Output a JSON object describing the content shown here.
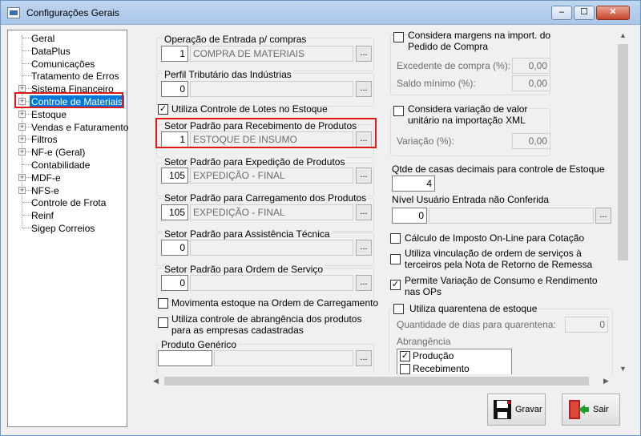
{
  "window": {
    "title": "Configurações Gerais",
    "min": "–",
    "max": "☐",
    "close": "✕"
  },
  "tree": {
    "items": [
      {
        "label": "Geral",
        "expandable": false
      },
      {
        "label": "DataPlus",
        "expandable": false
      },
      {
        "label": "Comunicações",
        "expandable": false
      },
      {
        "label": "Tratamento de Erros",
        "expandable": false
      },
      {
        "label": "Sistema Financeiro",
        "expandable": true
      },
      {
        "label": "Controle de Materiais",
        "expandable": true,
        "selected": true
      },
      {
        "label": "Estoque",
        "expandable": true
      },
      {
        "label": "Vendas e Faturamento",
        "expandable": true
      },
      {
        "label": "Filtros",
        "expandable": true
      },
      {
        "label": "NF-e (Geral)",
        "expandable": true
      },
      {
        "label": "Contabilidade",
        "expandable": false
      },
      {
        "label": "MDF-e",
        "expandable": true
      },
      {
        "label": "NFS-e",
        "expandable": true
      },
      {
        "label": "Controle de Frota",
        "expandable": false
      },
      {
        "label": "Reinf",
        "expandable": false
      },
      {
        "label": "Sigep Correios",
        "expandable": false
      }
    ]
  },
  "left": {
    "op_entrada": {
      "label": "Operação de Entrada p/ compras",
      "code": "1",
      "desc": "COMPRA DE MATERIAIS"
    },
    "perfil": {
      "label": "Perfil Tributário das Indústrias",
      "code": "0",
      "desc": ""
    },
    "lotes": {
      "label": "Utiliza Controle de Lotes no Estoque",
      "checked": true
    },
    "setor_receb": {
      "label": "Setor Padrão para Recebimento de Produtos",
      "code": "1",
      "desc": "ESTOQUE DE INSUMO"
    },
    "setor_exped": {
      "label": "Setor Padrão para Expedição de Produtos",
      "code": "105",
      "desc": "EXPEDIÇÃO - FINAL"
    },
    "setor_carreg": {
      "label": "Setor Padrão para Carregamento dos Produtos",
      "code": "105",
      "desc": "EXPEDIÇÃO - FINAL"
    },
    "setor_assist": {
      "label": "Setor Padrão para Assistência Técnica",
      "code": "0",
      "desc": ""
    },
    "setor_os": {
      "label": "Setor Padrão para Ordem de Serviço",
      "code": "0",
      "desc": ""
    },
    "movimenta": {
      "label": "Movimenta estoque na Ordem de Carregamento",
      "checked": false
    },
    "abrangencia": {
      "label1": "Utiliza controle de abrangência dos produtos",
      "label2": "para as empresas cadastradas",
      "checked": false
    },
    "produto_generico": {
      "label": "Produto Genérico",
      "code": "",
      "desc": ""
    }
  },
  "right": {
    "margens": {
      "label1": "Considera margens na import. do",
      "label2": "Pedido de Compra",
      "checked": false,
      "excedente_label": "Excedente de compra (%):",
      "excedente": "0,00",
      "saldo_label": "Saldo mínimo (%):",
      "saldo": "0,00"
    },
    "variacao": {
      "label1": "Considera variação de valor",
      "label2": "unitário na importação XML",
      "checked": false,
      "variacao_label": "Variação (%):",
      "variacao_val": "0,00"
    },
    "casas": {
      "label": "Qtde de casas decimais para controle de Estoque",
      "value": "4"
    },
    "nivel": {
      "label": "Nível Usuário Entrada não Conferida",
      "value": "0",
      "desc": ""
    },
    "calculo": {
      "label": "Cálculo de Imposto On-Line para Cotação",
      "checked": false
    },
    "vinculacao": {
      "label1": "Utiliza vinculação de ordem de serviços à",
      "label2": "terceiros pela Nota de Retorno de Remessa",
      "checked": false
    },
    "permite": {
      "label1": "Permite Variação de Consumo e Rendimento",
      "label2": "nas OPs",
      "checked": true
    },
    "quarentena": {
      "label": "Utiliza quarentena de estoque",
      "checked": false,
      "dias_label": "Quantidade de dias para quarentena:",
      "dias": "0",
      "abr_label": "Abrangência",
      "opcoes": [
        {
          "label": "Produção",
          "checked": true
        },
        {
          "label": "Recebimento",
          "checked": false
        }
      ]
    }
  },
  "buttons": {
    "gravar": "Gravar",
    "sair": "Sair"
  },
  "ellipsis": "..."
}
